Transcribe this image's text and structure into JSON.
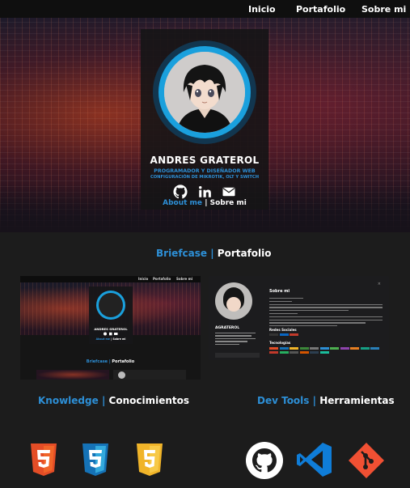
{
  "nav": {
    "items": [
      "Inicio",
      "Portafolio",
      "Sobre mi"
    ]
  },
  "profile": {
    "name": "ANDRES GRATEROL",
    "role": "PROGRAMADOR Y DISEÑADOR WEB",
    "role2": "CONFIGURACIÓN DE MIKROTIK, OLT Y SWITCH",
    "social_icons": [
      "github-icon",
      "linkedin-icon",
      "mail-icon"
    ],
    "link_about": "About me",
    "separator": "|",
    "link_sobre": "Sobre mi"
  },
  "sections": {
    "portfolio": {
      "en": "Briefcase",
      "sep": "|",
      "es": "Portafolio"
    },
    "knowledge": {
      "en": "Knowledge",
      "sep": "|",
      "es": "Conocimientos"
    },
    "devtools": {
      "en": "Dev Tools",
      "sep": "|",
      "es": "Herramientas"
    }
  },
  "preview1": {
    "nav": [
      "Inicio",
      "Portafolio",
      "Sobre mi"
    ],
    "name": "ANDRES GRATEROL",
    "link_about": "About me",
    "sep": "|",
    "link_sobre": "Sobre mi",
    "title_en": "Briefcase",
    "title_sep": "|",
    "title_es": "Portafolio"
  },
  "preview2": {
    "name": "AGRATEROL",
    "title": "Sobre mi",
    "section1": "Redes Sociales",
    "section2": "Tecnologías"
  },
  "knowledge_logos": [
    "html5-icon",
    "css3-icon",
    "javascript-icon"
  ],
  "tool_logos": [
    "github-icon",
    "vscode-icon",
    "git-icon"
  ],
  "colors": {
    "accent": "#2d8fd6",
    "background": "#1c1c1c",
    "html5": "#e44d26",
    "css3": "#1572b6",
    "js": "#f0b429",
    "git": "#f05033",
    "vscode": "#0f7dd8"
  }
}
